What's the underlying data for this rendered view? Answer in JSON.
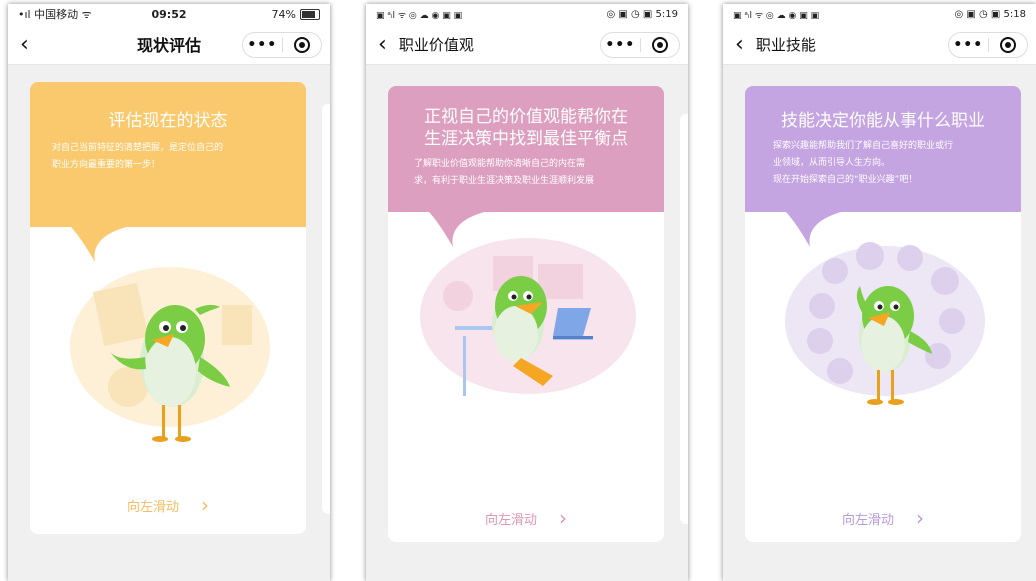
{
  "phones": [
    {
      "status": {
        "left": "•ıl 中国移动 ᯤ",
        "time": "09:52",
        "battery": "74%"
      },
      "nav": {
        "title": "现状评估",
        "more": "•••"
      },
      "bubble": {
        "title": "评估现在的状态",
        "lines": [
          "对自己当前特征的清楚把握，是定位自己的",
          "职业方向最重要的第一步！"
        ]
      },
      "swipe": {
        "label": "向左滑动",
        "chevron": "›"
      },
      "colors": {
        "bubble": "#fac96d",
        "swipe": "#f5bd62",
        "accent_bg": "#fdf0d6"
      }
    },
    {
      "status": {
        "left": "▣ ᵃᵢl ᯤ ◎ ☁ ◉ ▣ ▣",
        "right": "◎ ▣ ◷ ▣ 5:19"
      },
      "nav": {
        "title": "职业价值观",
        "more": "•••"
      },
      "bubble": {
        "title_lines": [
          "正视自己的价值观能帮你在",
          "生涯决策中找到最佳平衡点"
        ],
        "lines": [
          "了解职业价值观能帮助你清晰自己的内在需",
          "求，有利于职业生涯决策及职业生涯顺利发展"
        ]
      },
      "swipe": {
        "label": "向左滑动",
        "chevron": "›"
      },
      "colors": {
        "bubble": "#dd9fbf",
        "swipe": "#dc97b6",
        "accent_bg": "#f8e4ec"
      }
    },
    {
      "status": {
        "left": "▣ ᵃᵢl ᯤ ◎ ☁ ◉ ▣ ▣",
        "right": "◎ ▣ ◷ ▣ 5:18"
      },
      "nav": {
        "title": "职业技能",
        "more": "•••"
      },
      "bubble": {
        "title": "技能决定你能从事什么职业",
        "lines": [
          "探索兴趣能帮助我们了解自己喜好的职业或行",
          "业领域，从而引导人生方向。",
          "现在开始探索自己的“职业兴趣”吧！"
        ]
      },
      "swipe": {
        "label": "向左滑动",
        "chevron": "›"
      },
      "colors": {
        "bubble": "#c4a4e1",
        "swipe": "#b99ad8",
        "accent_bg": "#ede6f5"
      }
    }
  ]
}
